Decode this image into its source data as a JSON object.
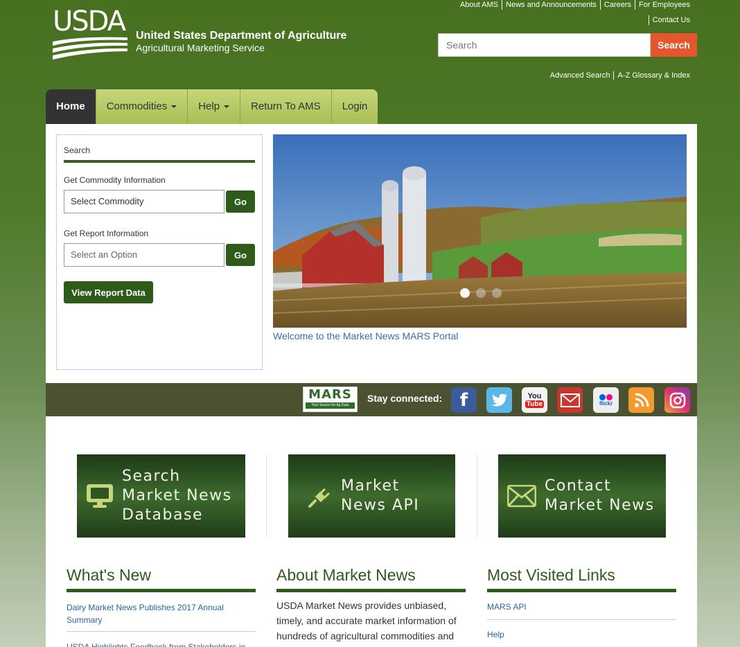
{
  "header": {
    "logo_text": "USDA",
    "org_line1": "United States Department of Agriculture",
    "org_line2": "Agricultural Marketing Service",
    "top_links": [
      "About AMS",
      "News and Announcements",
      "Careers",
      "For Employees"
    ],
    "top_links_row2": [
      "Contact Us"
    ],
    "search_placeholder": "Search",
    "search_button": "Search",
    "sub_links": [
      "Advanced Search",
      "A-Z Glossary & Index"
    ]
  },
  "nav": {
    "items": [
      {
        "label": "Home",
        "active": true
      },
      {
        "label": "Commodities",
        "dropdown": true
      },
      {
        "label": "Help",
        "dropdown": true
      },
      {
        "label": "Return To AMS"
      },
      {
        "label": "Login"
      }
    ]
  },
  "search_panel": {
    "title": "Search",
    "commodity_label": "Get Commodity Information",
    "commodity_value": "Select Commodity",
    "report_label": "Get Report Information",
    "report_placeholder": "Select an Option",
    "go_label": "Go",
    "view_report_button": "View Report Data"
  },
  "hero": {
    "caption": "Welcome to the Market News MARS Portal",
    "slide_count": 3,
    "active_slide": 1
  },
  "social": {
    "mars_logo_text": "MARS",
    "mars_tagline": "Your Source for Ag Data",
    "stay_connected": "Stay connected:",
    "icons": [
      "facebook-icon",
      "twitter-icon",
      "youtube-icon",
      "email-icon",
      "flickr-icon",
      "rss-icon",
      "instagram-icon"
    ]
  },
  "tiles": [
    {
      "name": "search-database",
      "lines": [
        "Search",
        "Market News",
        "Database"
      ],
      "icon": "monitor-icon"
    },
    {
      "name": "market-news-api",
      "lines": [
        "Market",
        "News API"
      ],
      "icon": "plug-icon"
    },
    {
      "name": "contact-market-news",
      "lines": [
        "Contact",
        "Market News"
      ],
      "icon": "envelope-icon"
    }
  ],
  "whats_new": {
    "title": "What's New",
    "items": [
      "Dairy Market News Publishes 2017 Annual Summary",
      "USDA Highlights Feedback from Stakeholders in"
    ]
  },
  "about": {
    "title": "About Market News",
    "text": "USDA Market News provides unbiased, timely, and accurate market information of hundreds of agricultural commodities and their related products"
  },
  "most_visited": {
    "title": "Most Visited Links",
    "items": [
      "MARS API",
      "Help"
    ]
  },
  "colors": {
    "header_green": "#47701f",
    "nav_lime": "#b8ca66",
    "button_green": "#2e5a1a",
    "search_orange": "#e4572e",
    "link_blue": "#2a62a8"
  }
}
